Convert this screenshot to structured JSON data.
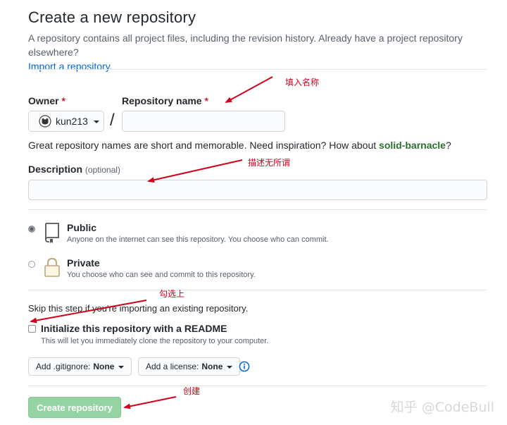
{
  "header": {
    "title": "Create a new repository",
    "subtitle": "A repository contains all project files, including the revision history. Already have a project repository elsewhere?",
    "import_link": "Import a repository."
  },
  "owner": {
    "label": "Owner",
    "required_mark": "*",
    "value": "kun213",
    "avatar_icon": "octocat-avatar-icon"
  },
  "separator": "/",
  "repo_name": {
    "label": "Repository name",
    "required_mark": "*",
    "value": "",
    "placeholder": ""
  },
  "name_hint": {
    "prefix": "Great repository names are short and memorable. Need inspiration? How about",
    "suggestion": "solid-barnacle",
    "suffix": "?"
  },
  "description": {
    "label": "Description",
    "optional": "(optional)",
    "value": ""
  },
  "visibility": {
    "selected": "public",
    "options": [
      {
        "key": "public",
        "title": "Public",
        "desc": "Anyone on the internet can see this repository. You choose who can commit.",
        "icon": "repo-book-icon"
      },
      {
        "key": "private",
        "title": "Private",
        "desc": "You choose who can see and commit to this repository.",
        "icon": "lock-icon"
      }
    ]
  },
  "init": {
    "skip_text": "Skip this step if you're importing an existing repository.",
    "readme_label": "Initialize this repository with a README",
    "readme_desc": "This will let you immediately clone the repository to your computer.",
    "readme_checked": false
  },
  "selects": {
    "gitignore_prefix": "Add .gitignore:",
    "gitignore_value": "None",
    "license_prefix": "Add a license:",
    "license_value": "None"
  },
  "create_button": "Create repository",
  "annotations": {
    "fill_name": "填入名称",
    "description_any": "描述无所谓",
    "check_it": "勾选上",
    "create": "创建"
  },
  "watermark": "知乎 @CodeBull",
  "colors": {
    "link": "#0366d6",
    "annotation_red": "#d0021b",
    "create_button_bg": "#94d3a2"
  }
}
